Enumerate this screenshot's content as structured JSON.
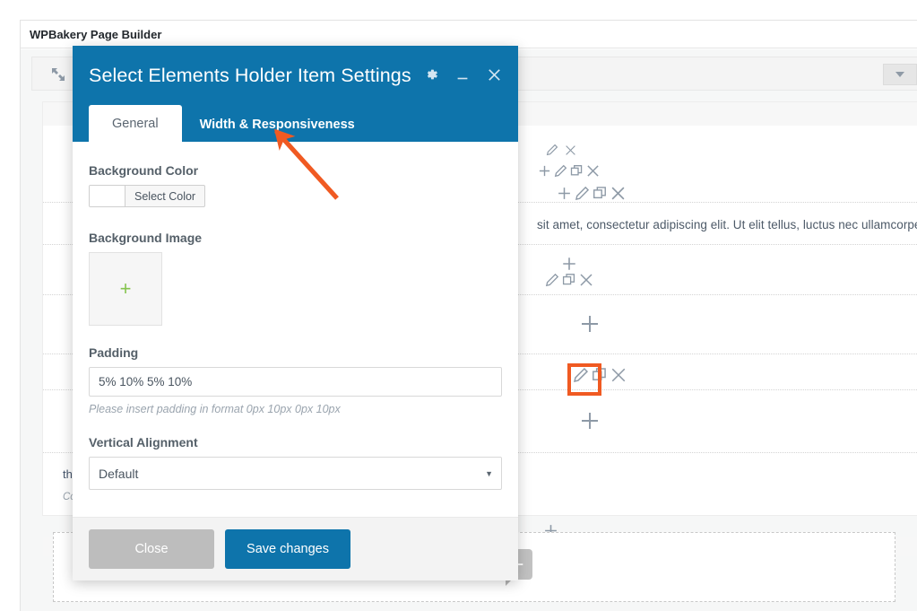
{
  "page": {
    "panel_title": "WPBakery Page Builder"
  },
  "toolbar": {
    "move_icon": "move-arrows-icon",
    "list_icon": "list-view-icon",
    "dropdown_icon": "chevron-down-icon"
  },
  "canvas": {
    "row_handle_icon": "move-arrows-icon",
    "layout_thumb_icon": "row-layout-icon",
    "paragraph": "sit amet, consectetur adipiscing elit. Ut elit tellus, luctus nec ullamcorper matti",
    "column_label": "three_",
    "column_sublabel": "Colum",
    "add_element_glyph": "+",
    "icons": {
      "edit": "pencil-icon",
      "clone": "copy-icon",
      "delete": "close-icon",
      "add": "plus-icon"
    },
    "highlight_color": "#F05A22"
  },
  "modal": {
    "title": "Select Elements Holder Item Settings",
    "header_color": "#0e74ab",
    "actions": [
      {
        "name": "settings-gear-button",
        "icon": "gear-icon"
      },
      {
        "name": "minimize-button",
        "icon": "minimize-icon"
      },
      {
        "name": "close-button",
        "icon": "close-icon"
      }
    ],
    "tabs": [
      {
        "label": "General",
        "active": true
      },
      {
        "label": "Width & Responsiveness",
        "active": false
      }
    ],
    "fields": {
      "background_color": {
        "label": "Background Color",
        "button_label": "Select Color",
        "swatch_color": "#ffffff"
      },
      "background_image": {
        "label": "Background Image",
        "add_glyph": "+"
      },
      "padding": {
        "label": "Padding",
        "value": "5% 10% 5% 10%",
        "placeholder": "",
        "hint": "Please insert padding in format 0px 10px 0px 10px"
      },
      "vertical_alignment": {
        "label": "Vertical Alignment",
        "value": "Default",
        "arrow_glyph": "▼",
        "options": [
          "Default"
        ]
      }
    },
    "footer": {
      "close_label": "Close",
      "save_label": "Save changes",
      "save_color": "#0e74ab",
      "close_color": "#bdbdbd"
    }
  },
  "annotation": {
    "arrow_color": "#F05A22",
    "points_to": "Width & Responsiveness"
  }
}
